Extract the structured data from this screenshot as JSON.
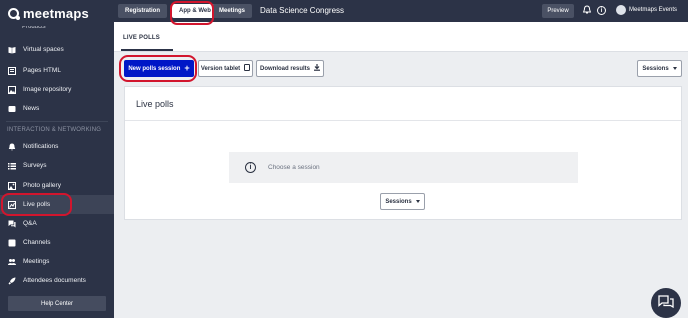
{
  "brand": {
    "logo_text": "meetmaps"
  },
  "sidebar": {
    "partial_top_item": "Products",
    "items_top": [
      {
        "label": "Virtual spaces",
        "icon": "book-icon"
      },
      {
        "label": "Pages HTML",
        "icon": "page-icon"
      },
      {
        "label": "Image repository",
        "icon": "image-icon"
      },
      {
        "label": "News",
        "icon": "news-icon"
      }
    ],
    "section_label": "INTERACTION & NETWORKING",
    "items_bottom": [
      {
        "label": "Notifications",
        "icon": "bell-icon"
      },
      {
        "label": "Surveys",
        "icon": "list-icon"
      },
      {
        "label": "Photo gallery",
        "icon": "photo-icon"
      },
      {
        "label": "Live polls",
        "icon": "chart-icon",
        "active": true
      },
      {
        "label": "Q&A",
        "icon": "qa-icon"
      },
      {
        "label": "Channels",
        "icon": "channels-icon"
      },
      {
        "label": "Meetings",
        "icon": "meetings-icon"
      },
      {
        "label": "Attendees documents",
        "icon": "rocket-icon"
      }
    ],
    "help_label": "Help Center"
  },
  "topbar": {
    "tabs": [
      "Registration",
      "App & Web",
      "Meetings"
    ],
    "active_tab": "App & Web",
    "event_title": "Data Science Congress",
    "preview_label": "Preview",
    "user_name": "Meetmaps Events"
  },
  "page": {
    "tab_label": "LIVE POLLS",
    "toolbar": {
      "new_session": "New polls session",
      "version_tablet": "Version tablet",
      "download_results": "Download results",
      "sessions": "Sessions"
    },
    "card": {
      "title": "Live polls",
      "notice": "Choose a session",
      "sessions": "Sessions"
    }
  },
  "colors": {
    "sidebar_bg": "#2c3347",
    "primary": "#0017c7",
    "highlight": "#d2152d"
  }
}
